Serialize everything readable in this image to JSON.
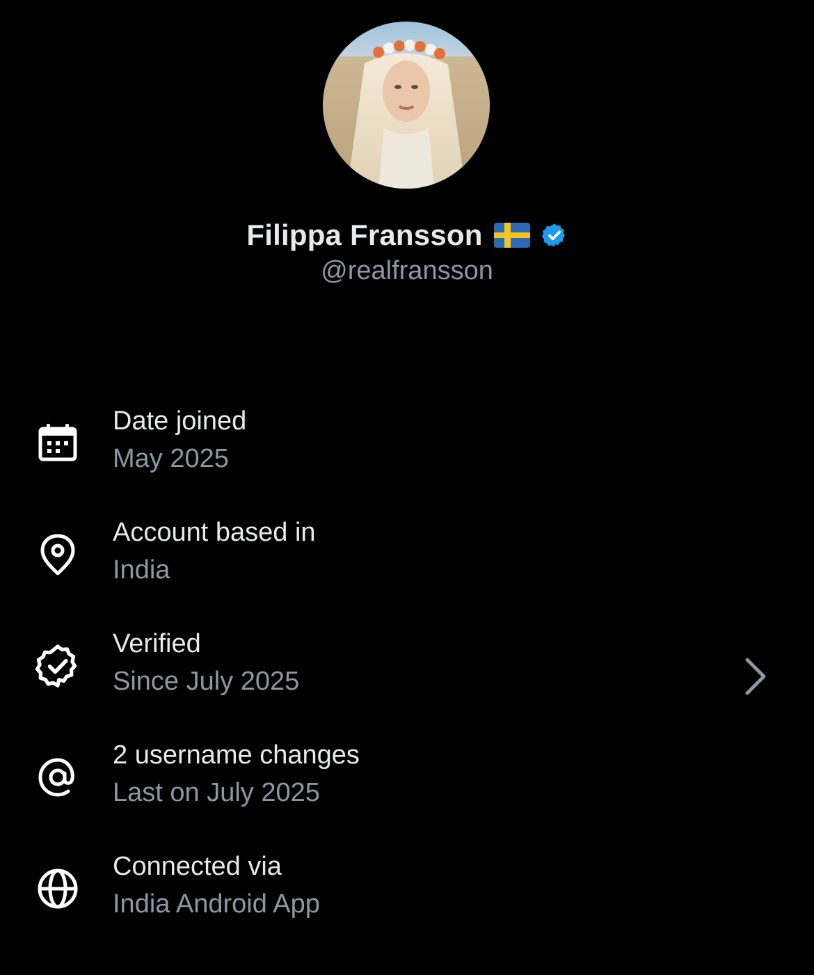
{
  "profile": {
    "display_name": "Filippa Fransson",
    "flag_icon": "sweden-flag-icon",
    "verified_icon": "verified-badge-icon",
    "verified_color": "#1d9bf0",
    "handle": "@realfransson"
  },
  "about": [
    {
      "icon": "calendar-icon",
      "title": "Date joined",
      "value": "May 2025"
    },
    {
      "icon": "location-pin-icon",
      "title": "Account based in",
      "value": "India"
    },
    {
      "icon": "verified-outline-icon",
      "title": "Verified",
      "value": "Since July 2025"
    },
    {
      "icon": "at-sign-icon",
      "title": "2 username changes",
      "value": "Last on July 2025"
    },
    {
      "icon": "globe-icon",
      "title": "Connected via",
      "value": "India Android App"
    }
  ],
  "colors": {
    "background": "#000000",
    "primary_text": "#e7e9ea",
    "secondary_text": "#8b98a5"
  }
}
